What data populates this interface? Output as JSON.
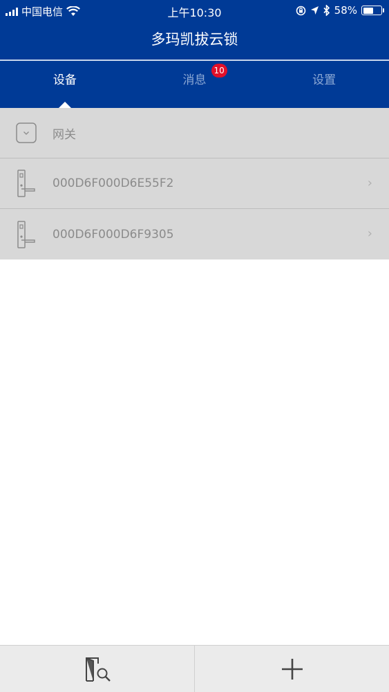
{
  "status_bar": {
    "carrier": "中国电信",
    "time": "上午10:30",
    "battery": "58%",
    "battery_level": 0.58
  },
  "nav": {
    "title": "多玛凯拔云锁"
  },
  "tabs": [
    {
      "label": "设备",
      "active": true
    },
    {
      "label": "消息",
      "badge": "10"
    },
    {
      "label": "设置"
    }
  ],
  "list": [
    {
      "label": "网关",
      "icon": "gateway-icon"
    },
    {
      "label": "000D6F000D6E55F2",
      "icon": "door-lock-icon"
    },
    {
      "label": "000D6F000D6F9305",
      "icon": "door-lock-icon"
    }
  ],
  "bottom_bar": {
    "left_icon": "door-search-icon",
    "right_icon": "plus-icon"
  },
  "colors": {
    "brand": "#003a96",
    "badge": "#e1102a",
    "list_bg": "#d8d8d8"
  }
}
